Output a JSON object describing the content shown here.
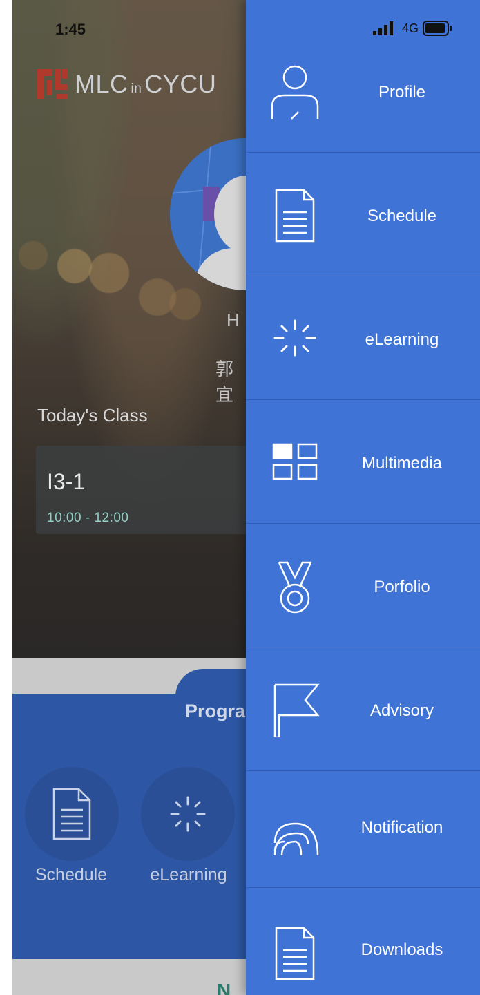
{
  "status": {
    "time": "1:45",
    "network": "4G"
  },
  "app": {
    "logo": {
      "mlc": "MLC",
      "in": "in",
      "cycu": "CYCU"
    },
    "profile": {
      "name_partial": "H",
      "cn_partial": "郭宜"
    },
    "today": {
      "heading": "Today's Class",
      "class_name": "I3-1",
      "class_time": "10:00 - 12:00"
    },
    "programs": {
      "title_partial": "Progra",
      "items": [
        {
          "label": "Schedule",
          "icon": "document-icon"
        },
        {
          "label": "eLearning",
          "icon": "spinner-icon"
        }
      ]
    },
    "bottom_partial": "N"
  },
  "drawer": {
    "items": [
      {
        "label": "Profile",
        "icon": "person-icon"
      },
      {
        "label": "Schedule",
        "icon": "document-icon"
      },
      {
        "label": "eLearning",
        "icon": "spinner-icon"
      },
      {
        "label": "Multimedia",
        "icon": "grid-icon"
      },
      {
        "label": "Porfolio",
        "icon": "medal-icon"
      },
      {
        "label": "Advisory",
        "icon": "flag-icon"
      },
      {
        "label": "Notification",
        "icon": "rss-icon"
      },
      {
        "label": "Downloads",
        "icon": "document-icon"
      }
    ]
  },
  "colors": {
    "drawer": "#3f73d6",
    "programs": "#2d57a4",
    "class_time": "#8fd0c4",
    "logo_mark": "#c0392b"
  }
}
